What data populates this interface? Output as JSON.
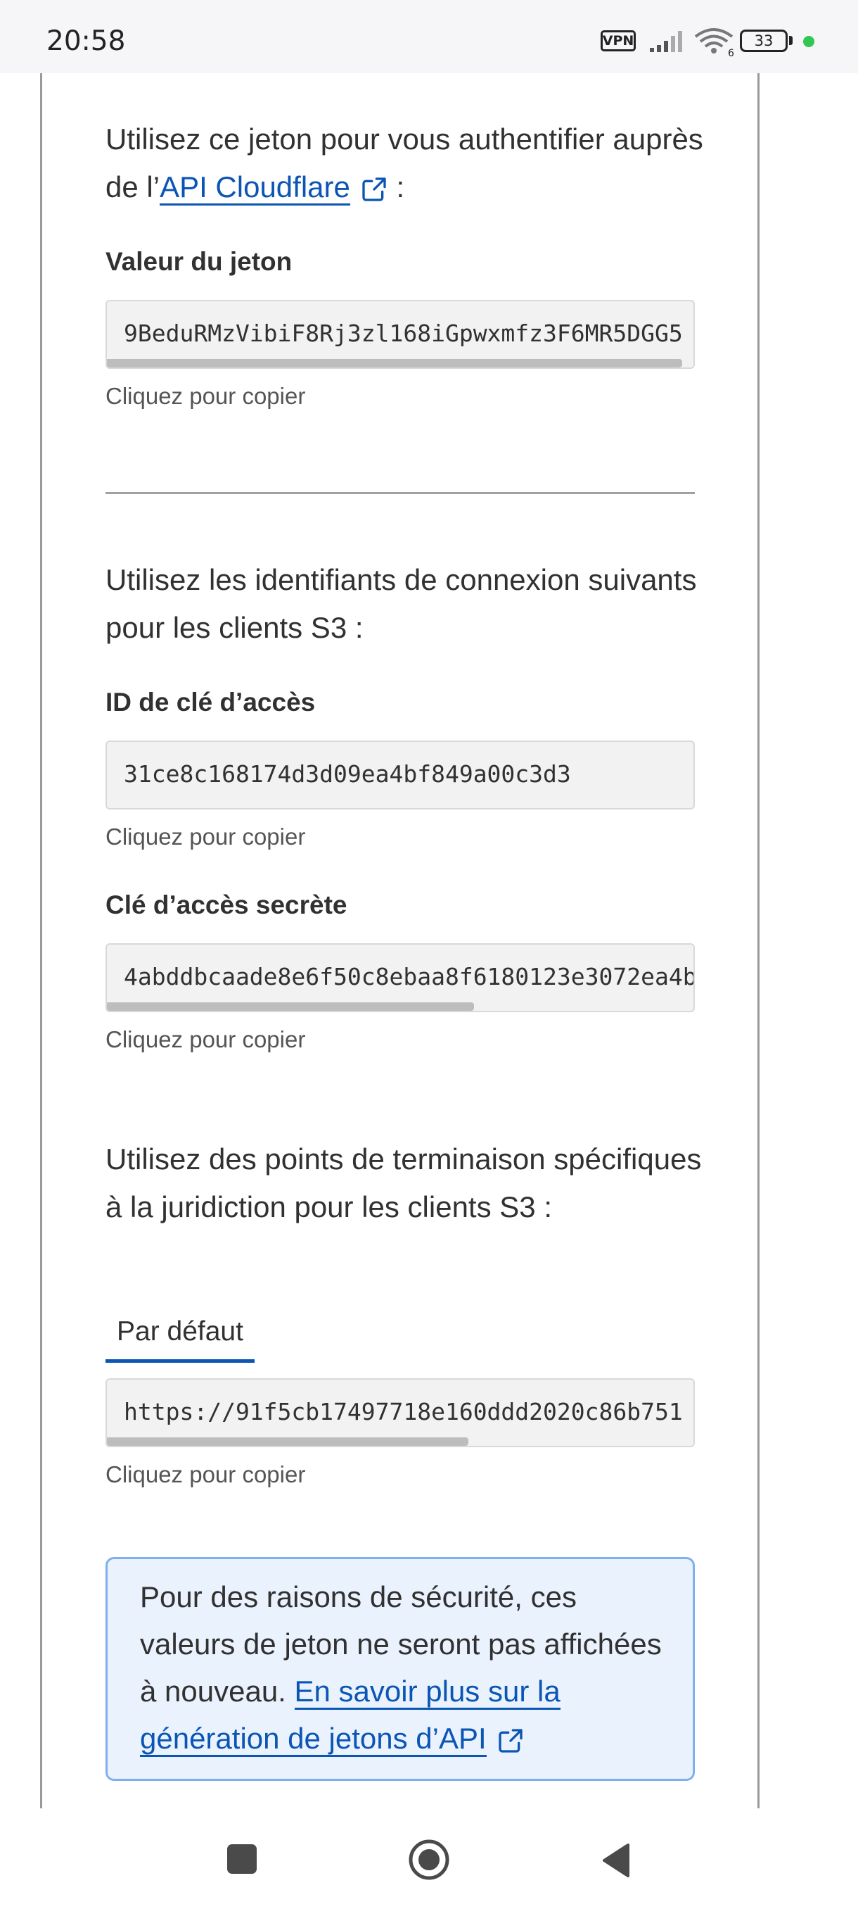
{
  "status_bar": {
    "time": "20:58",
    "vpn_label": "VPN",
    "battery_level": "33",
    "wifi_badge": "6"
  },
  "section_api": {
    "intro_text": "Utilisez ce jeton pour vous authentifier auprès de l’",
    "link_text": "API Cloudflare",
    "suffix": " :",
    "token_label": "Valeur du jeton",
    "token_value": "9BeduRMzVibiF8Rj3zl168iGpwxmfz3F6MR5DGG5",
    "copy_hint": "Cliquez pour copier"
  },
  "section_s3": {
    "intro_text": "Utilisez les identifiants de connexion suivants pour les clients S3 :",
    "access_key_label": "ID de clé d’accès",
    "access_key_value": "31ce8c168174d3d09ea4bf849a00c3d3",
    "access_key_hint": "Cliquez pour copier",
    "secret_key_label": "Clé d’accès secrète",
    "secret_key_value": "4abddbcaade8e6f50c8ebaa8f6180123e3072ea4b",
    "secret_key_hint": "Cliquez pour copier"
  },
  "section_endpoints": {
    "intro_text": "Utilisez des points de terminaison spécifiques à la juridiction pour les clients S3 :",
    "tab_default": "Par défaut",
    "endpoint_value": "https://91f5cb17497718e160ddd2020c86b751",
    "copy_hint": "Cliquez pour copier"
  },
  "notice": {
    "text": "Pour des raisons de sécurité, ces valeurs de jeton ne seront pas affichées à nouveau. ",
    "link_text": "En savoir plus sur la génération de jetons d’API"
  },
  "colors": {
    "link": "#0b55b5",
    "notice_bg": "#eaf2fd",
    "notice_border": "#7fb0ee",
    "status_green": "#32c652"
  }
}
